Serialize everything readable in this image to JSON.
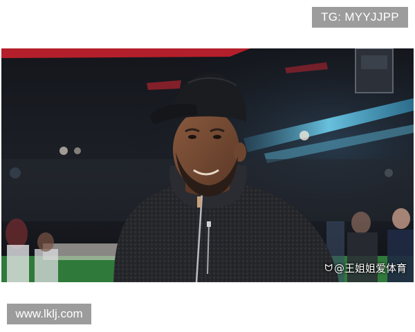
{
  "top_tag": {
    "text": "TG: MYYJJPP"
  },
  "photo": {
    "subject": "man-in-cap-and-dark-zip-fleece",
    "watermark_text": "@王姐姐爱体育",
    "watermark_icon": "weibo-icon"
  },
  "bottom_tag": {
    "text": "www.lklj.com"
  },
  "colors": {
    "tag_bg": "#9c9c9c",
    "stadium_dark": "#0d0f14",
    "stadium_red": "#c4202c",
    "stadium_cyan": "#4fb8d8",
    "pitch_green": "#2f7a3a"
  }
}
